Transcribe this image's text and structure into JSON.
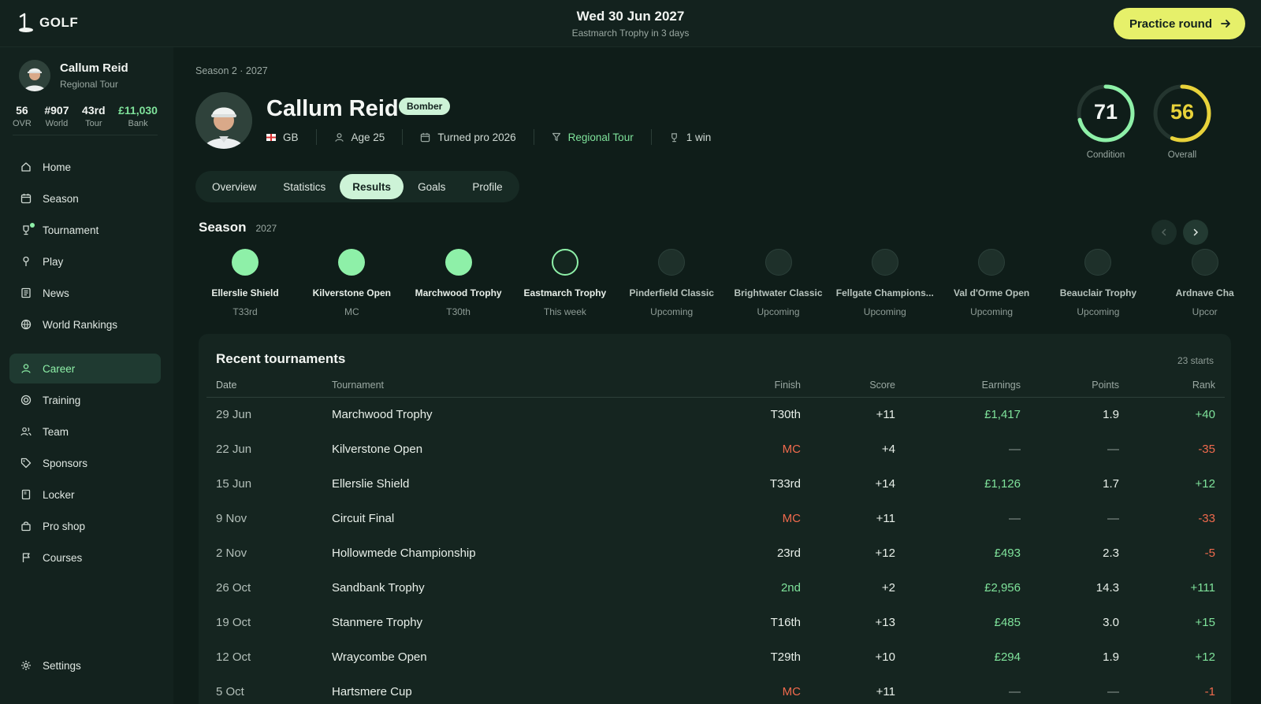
{
  "app": {
    "logo_text": "GOLF"
  },
  "header": {
    "date": "Wed 30 Jun 2027",
    "subtitle": "Eastmarch Trophy in 3 days",
    "practice_label": "Practice round"
  },
  "sidebar": {
    "player_name": "Callum Reid",
    "player_tour": "Regional Tour",
    "stats": [
      {
        "value": "56",
        "label": "OVR"
      },
      {
        "value": "#907",
        "label": "World"
      },
      {
        "value": "43rd",
        "label": "Tour"
      },
      {
        "value": "£11,030",
        "label": "Bank"
      }
    ],
    "nav": [
      {
        "label": "Home"
      },
      {
        "label": "Season"
      },
      {
        "label": "Tournament"
      },
      {
        "label": "Play"
      },
      {
        "label": "News"
      },
      {
        "label": "World Rankings"
      }
    ],
    "nav2": [
      {
        "label": "Career"
      },
      {
        "label": "Training"
      },
      {
        "label": "Team"
      },
      {
        "label": "Sponsors"
      },
      {
        "label": "Locker"
      },
      {
        "label": "Pro shop"
      },
      {
        "label": "Courses"
      }
    ],
    "settings_label": "Settings"
  },
  "player": {
    "season_label": "Season 2 · 2027",
    "name": "Callum Reid",
    "badge": "Bomber",
    "country": "GB",
    "age": "Age 25",
    "turned_pro": "Turned pro 2026",
    "tour": "Regional Tour",
    "wins": "1 win"
  },
  "gauges": [
    {
      "value": "71",
      "label": "Condition",
      "level": 71,
      "color": "#8ef0a8"
    },
    {
      "value": "56",
      "label": "Overall",
      "level": 56,
      "color": "#e8d23a"
    }
  ],
  "tabs": [
    "Overview",
    "Statistics",
    "Results",
    "Goals",
    "Profile"
  ],
  "season": {
    "title": "Season",
    "year": "2027",
    "events": [
      {
        "name": "Ellerslie Shield",
        "status": "T33rd",
        "state": "done"
      },
      {
        "name": "Kilverstone Open",
        "status": "MC",
        "state": "done"
      },
      {
        "name": "Marchwood Trophy",
        "status": "T30th",
        "state": "done"
      },
      {
        "name": "Eastmarch Trophy",
        "status": "This week",
        "state": "current"
      },
      {
        "name": "Pinderfield Classic",
        "status": "Upcoming",
        "state": "upcoming"
      },
      {
        "name": "Brightwater Classic",
        "status": "Upcoming",
        "state": "upcoming"
      },
      {
        "name": "Fellgate Champions...",
        "status": "Upcoming",
        "state": "upcoming"
      },
      {
        "name": "Val d'Orme Open",
        "status": "Upcoming",
        "state": "upcoming"
      },
      {
        "name": "Beauclair Trophy",
        "status": "Upcoming",
        "state": "upcoming"
      },
      {
        "name": "Ardnave Cha",
        "status": "Upcor",
        "state": "upcoming"
      }
    ]
  },
  "recent": {
    "title": "Recent tournaments",
    "count": "23 starts",
    "columns": [
      "Date",
      "Tournament",
      "Finish",
      "Score",
      "Earnings",
      "Points",
      "Rank"
    ],
    "rows": [
      {
        "date": "29 Jun",
        "tournament": "Marchwood Trophy",
        "finish": "T30th",
        "score": "+11",
        "earnings": "£1,417",
        "points": "1.9",
        "rank": "+40"
      },
      {
        "date": "22 Jun",
        "tournament": "Kilverstone Open",
        "finish": "MC",
        "score": "+4",
        "earnings": "—",
        "points": "—",
        "rank": "-35"
      },
      {
        "date": "15 Jun",
        "tournament": "Ellerslie Shield",
        "finish": "T33rd",
        "score": "+14",
        "earnings": "£1,126",
        "points": "1.7",
        "rank": "+12"
      },
      {
        "date": "9 Nov",
        "tournament": "Circuit Final",
        "finish": "MC",
        "score": "+11",
        "earnings": "—",
        "points": "—",
        "rank": "-33"
      },
      {
        "date": "2 Nov",
        "tournament": "Hollowmede Championship",
        "finish": "23rd",
        "score": "+12",
        "earnings": "£493",
        "points": "2.3",
        "rank": "-5"
      },
      {
        "date": "26 Oct",
        "tournament": "Sandbank Trophy",
        "finish": "2nd",
        "score": "+2",
        "earnings": "£2,956",
        "points": "14.3",
        "rank": "+111"
      },
      {
        "date": "19 Oct",
        "tournament": "Stanmere Trophy",
        "finish": "T16th",
        "score": "+13",
        "earnings": "£485",
        "points": "3.0",
        "rank": "+15"
      },
      {
        "date": "12 Oct",
        "tournament": "Wraycombe Open",
        "finish": "T29th",
        "score": "+10",
        "earnings": "£294",
        "points": "1.9",
        "rank": "+12"
      },
      {
        "date": "5 Oct",
        "tournament": "Hartsmere Cup",
        "finish": "MC",
        "score": "+11",
        "earnings": "—",
        "points": "—",
        "rank": "-1"
      }
    ]
  }
}
